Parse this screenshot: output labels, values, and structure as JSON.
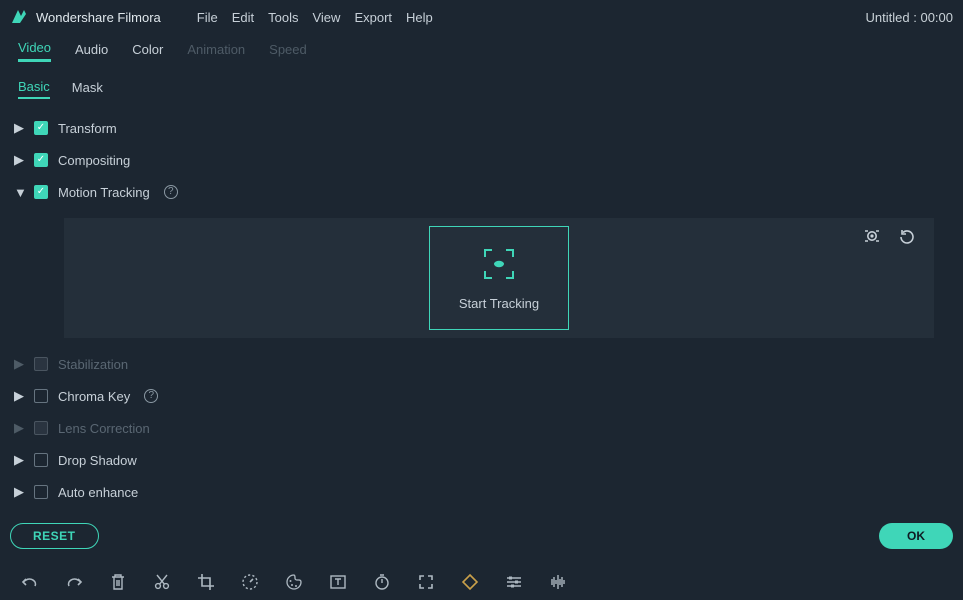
{
  "app_title": "Wondershare Filmora",
  "menu": {
    "file": "File",
    "edit": "Edit",
    "tools": "Tools",
    "view": "View",
    "export": "Export",
    "help": "Help"
  },
  "project_status": "Untitled : 00:00",
  "tabs_primary": {
    "video": "Video",
    "audio": "Audio",
    "color": "Color",
    "animation": "Animation",
    "speed": "Speed"
  },
  "tabs_secondary": {
    "basic": "Basic",
    "mask": "Mask"
  },
  "props": {
    "transform": "Transform",
    "compositing": "Compositing",
    "motion_tracking": "Motion Tracking",
    "stabilization": "Stabilization",
    "chroma_key": "Chroma Key",
    "lens_correction": "Lens Correction",
    "drop_shadow": "Drop Shadow",
    "auto_enhance": "Auto enhance"
  },
  "motion_tracking_panel": {
    "start_tracking": "Start Tracking"
  },
  "footer": {
    "reset": "RESET",
    "ok": "OK"
  },
  "colors": {
    "accent": "#3fd6b8",
    "bg": "#1c2631",
    "panel": "#242f3a"
  }
}
